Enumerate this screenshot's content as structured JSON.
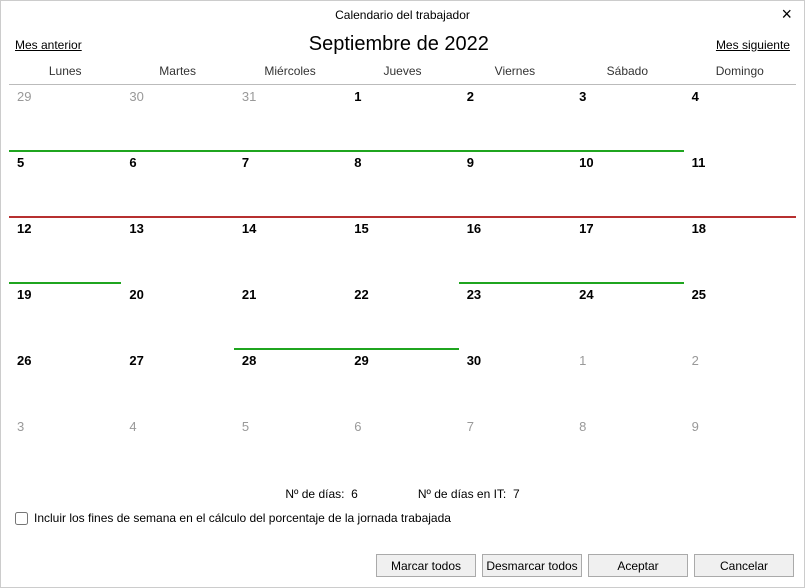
{
  "title": "Calendario del trabajador",
  "nav": {
    "prev": "Mes anterior",
    "month": "Septiembre de 2022",
    "next": "Mes siguiente"
  },
  "weekdays": [
    "Lunes",
    "Martes",
    "Miércoles",
    "Jueves",
    "Viernes",
    "Sábado",
    "Domingo"
  ],
  "cells": [
    {
      "n": "29",
      "other": true
    },
    {
      "n": "30",
      "other": true
    },
    {
      "n": "31",
      "other": true
    },
    {
      "n": "1"
    },
    {
      "n": "2"
    },
    {
      "n": "3"
    },
    {
      "n": "4"
    },
    {
      "n": "5",
      "u": "green"
    },
    {
      "n": "6",
      "u": "green"
    },
    {
      "n": "7",
      "u": "green"
    },
    {
      "n": "8",
      "u": "green"
    },
    {
      "n": "9",
      "u": "green"
    },
    {
      "n": "10",
      "u": "green"
    },
    {
      "n": "11"
    },
    {
      "n": "12",
      "u": "red"
    },
    {
      "n": "13",
      "u": "red"
    },
    {
      "n": "14",
      "u": "red"
    },
    {
      "n": "15",
      "u": "red"
    },
    {
      "n": "16",
      "u": "red"
    },
    {
      "n": "17",
      "u": "red"
    },
    {
      "n": "18",
      "u": "red"
    },
    {
      "n": "19",
      "u": "green"
    },
    {
      "n": "20"
    },
    {
      "n": "21"
    },
    {
      "n": "22"
    },
    {
      "n": "23",
      "u": "green"
    },
    {
      "n": "24",
      "u": "green"
    },
    {
      "n": "25"
    },
    {
      "n": "26"
    },
    {
      "n": "27"
    },
    {
      "n": "28",
      "u": "green"
    },
    {
      "n": "29",
      "u": "green"
    },
    {
      "n": "30"
    },
    {
      "n": "1",
      "other": true
    },
    {
      "n": "2",
      "other": true
    },
    {
      "n": "3",
      "other": true
    },
    {
      "n": "4",
      "other": true
    },
    {
      "n": "5",
      "other": true
    },
    {
      "n": "6",
      "other": true
    },
    {
      "n": "7",
      "other": true
    },
    {
      "n": "8",
      "other": true
    },
    {
      "n": "9",
      "other": true
    }
  ],
  "counts": {
    "days_label": "Nº de días:",
    "days_value": "6",
    "it_label": "Nº de días en IT:",
    "it_value": "7"
  },
  "checkbox": {
    "checked": false,
    "label": "Incluir los fines de semana en el cálculo del porcentaje de la jornada trabajada"
  },
  "buttons": {
    "mark_all": "Marcar todos",
    "unmark_all": "Desmarcar todos",
    "accept": "Aceptar",
    "cancel": "Cancelar"
  }
}
